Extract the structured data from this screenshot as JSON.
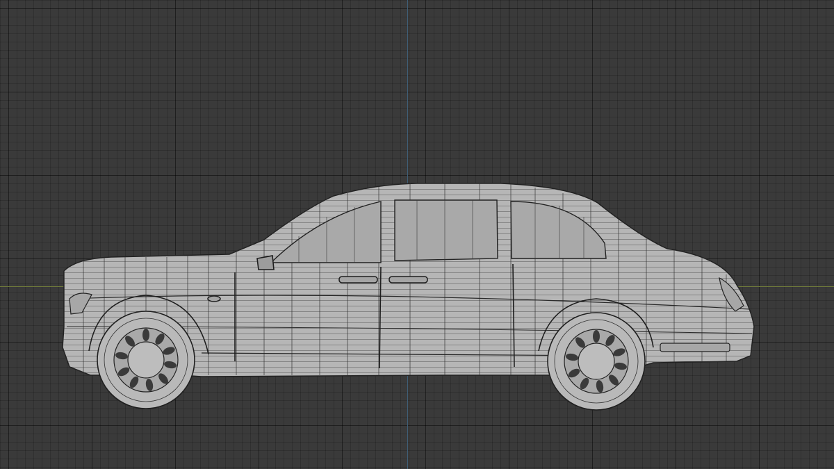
{
  "viewport": {
    "background_color": "#3a3a3a",
    "grid_color": "#2b2b2b",
    "x_axis_color": "#6f7a3a",
    "y_axis_color": "#3f5f78",
    "model_color": "#b4b4b4",
    "wire_color": "#2a2a2a"
  },
  "model": {
    "subject": "sedan-wireframe",
    "view": "side"
  }
}
